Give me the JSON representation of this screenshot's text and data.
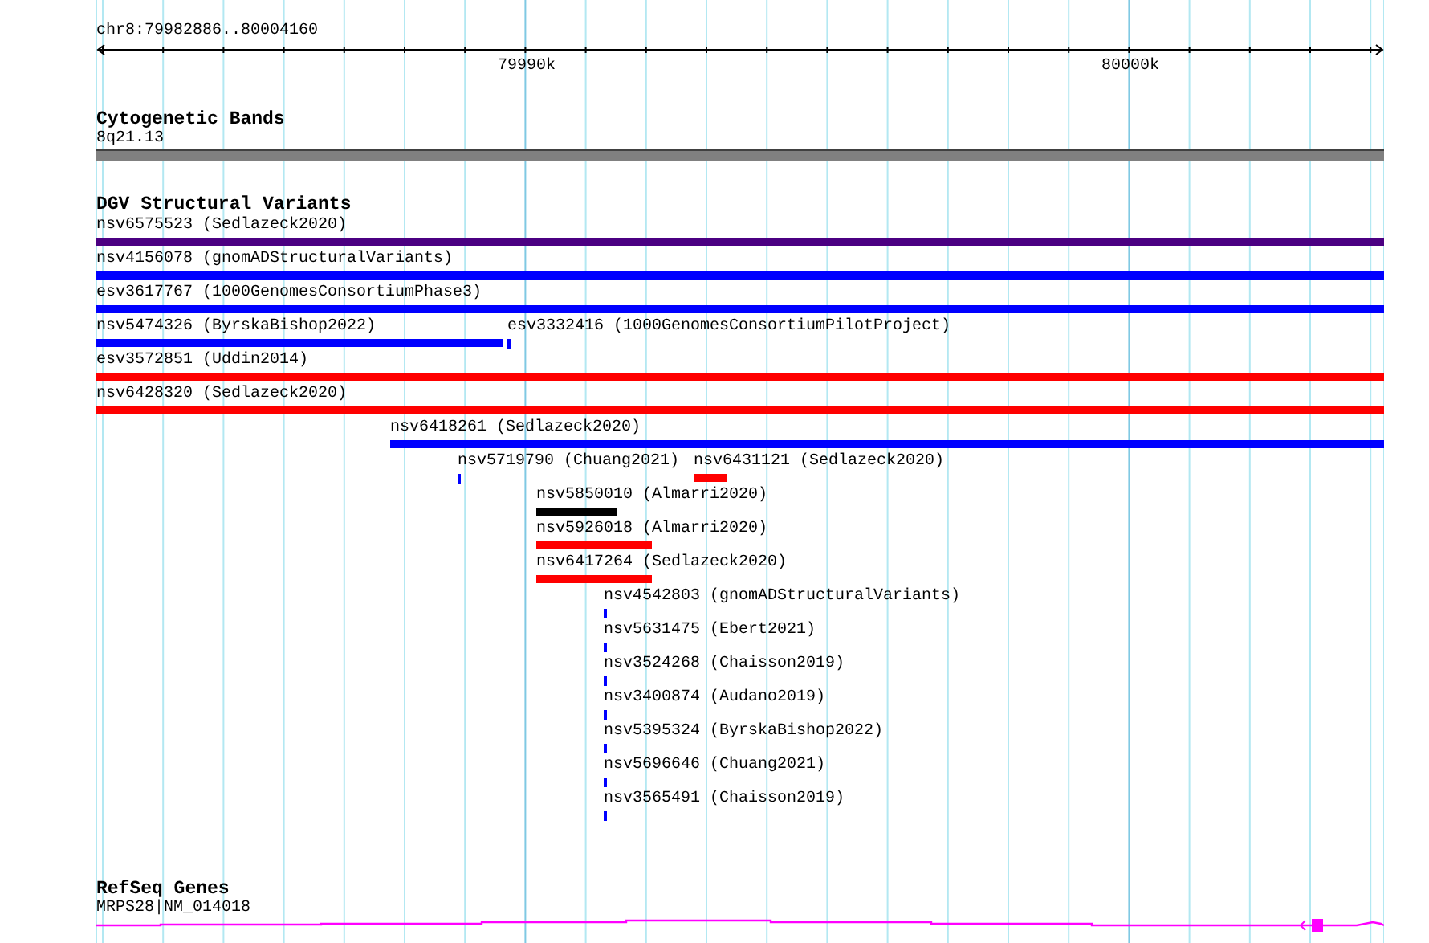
{
  "ruler": {
    "location": "chr8:79982886..80004160",
    "tick_labels": [
      "79990k",
      "80000k"
    ]
  },
  "cytogenetic_bands": {
    "title": "Cytogenetic Bands",
    "band": "8q21.13"
  },
  "dgv_structural_variants": {
    "title": "DGV Structural Variants",
    "features": [
      {
        "label": "nsv6575523 (Sedlazeck2020)",
        "color": "#4b0082"
      },
      {
        "label": "nsv4156078 (gnomADStructuralVariants)",
        "color": "#0000ff"
      },
      {
        "label": "esv3617767 (1000GenomesConsortiumPhase3)",
        "color": "#0000ff"
      },
      {
        "label": "nsv5474326 (ByrskaBishop2022)",
        "color": "#0000ff"
      },
      {
        "label": "esv3332416 (1000GenomesConsortiumPilotProject)",
        "color": "#0000ff"
      },
      {
        "label": "esv3572851 (Uddin2014)",
        "color": "#ff0000"
      },
      {
        "label": "nsv6428320 (Sedlazeck2020)",
        "color": "#ff0000"
      },
      {
        "label": "nsv6418261 (Sedlazeck2020)",
        "color": "#0000ff"
      },
      {
        "label": "nsv5719790 (Chuang2021)",
        "color": "#0000ff"
      },
      {
        "label": "nsv6431121 (Sedlazeck2020)",
        "color": "#ff0000"
      },
      {
        "label": "nsv5850010 (Almarri2020)",
        "color": "#000000"
      },
      {
        "label": "nsv5926018 (Almarri2020)",
        "color": "#ff0000"
      },
      {
        "label": "nsv6417264 (Sedlazeck2020)",
        "color": "#ff0000"
      },
      {
        "label": "nsv4542803 (gnomADStructuralVariants)",
        "color": "#0000ff"
      },
      {
        "label": "nsv5631475 (Ebert2021)",
        "color": "#0000ff"
      },
      {
        "label": "nsv3524268 (Chaisson2019)",
        "color": "#0000ff"
      },
      {
        "label": "nsv3400874 (Audano2019)",
        "color": "#0000ff"
      },
      {
        "label": "nsv5395324 (ByrskaBishop2022)",
        "color": "#0000ff"
      },
      {
        "label": "nsv5696646 (Chuang2021)",
        "color": "#0000ff"
      },
      {
        "label": "nsv3565491 (Chaisson2019)",
        "color": "#0000ff"
      }
    ]
  },
  "refseq_genes": {
    "title": "RefSeq Genes",
    "gene": "MRPS28|NM_014018"
  }
}
